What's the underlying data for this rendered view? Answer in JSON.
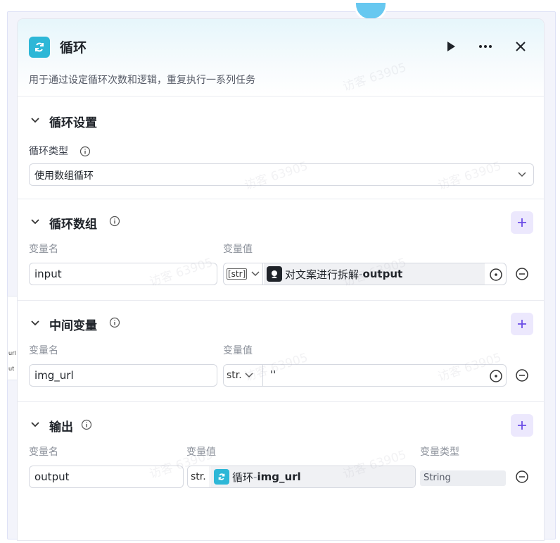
{
  "node": {
    "title": "循环",
    "description": "用于通过设定循环次数和逻辑，重复执行一系列任务",
    "icon": "loop-icon",
    "accent_color": "#2db7d7"
  },
  "header_actions": [
    "play-icon",
    "more-icon",
    "close-icon"
  ],
  "loop_settings": {
    "title": "循环设置",
    "type_label": "循环类型",
    "type_value": "使用数组循环"
  },
  "loop_array": {
    "title": "循环数组",
    "col_name": "变量名",
    "col_value": "变量值",
    "row": {
      "name": "input",
      "type_tag": "[str]",
      "ref_node": "对文案进行拆解",
      "ref_sep": " - ",
      "ref_var": "output"
    }
  },
  "intermediate": {
    "title": "中间变量",
    "col_name": "变量名",
    "col_value": "变量值",
    "row": {
      "name": "img_url",
      "type_tag": "str.",
      "value": "''"
    }
  },
  "output": {
    "title": "输出",
    "col_name": "变量名",
    "col_value": "变量值",
    "col_type": "变量类型",
    "row": {
      "name": "output",
      "type_tag": "str.",
      "ref_node": "循环",
      "ref_sep": " - ",
      "ref_var": "img_url",
      "var_type": "String"
    }
  },
  "left_strip": {
    "a": "url",
    "b": "ut"
  },
  "watermark_text": "访客 63905"
}
